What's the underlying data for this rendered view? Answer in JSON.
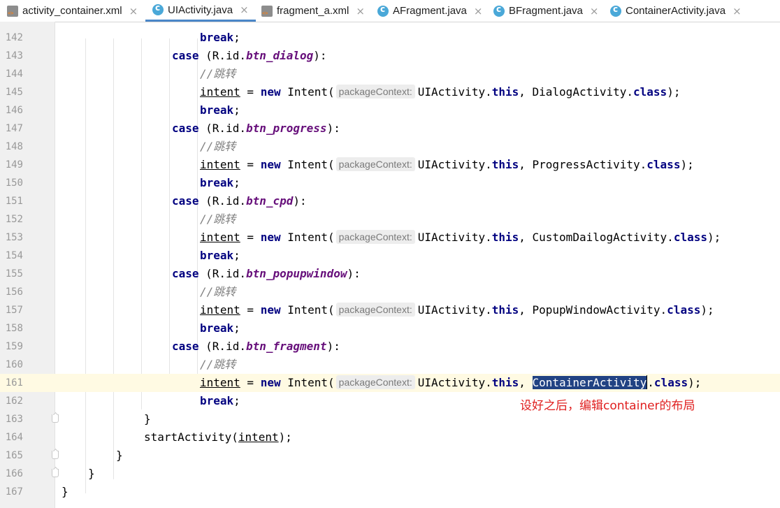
{
  "tabs": [
    {
      "name": "activity_container.xml",
      "type": "xml",
      "active": false
    },
    {
      "name": "UIActivity.java",
      "type": "java",
      "active": true
    },
    {
      "name": "fragment_a.xml",
      "type": "xml",
      "active": false
    },
    {
      "name": "AFragment.java",
      "type": "java",
      "active": false
    },
    {
      "name": "BFragment.java",
      "type": "java",
      "active": false
    },
    {
      "name": "ContainerActivity.java",
      "type": "java",
      "active": false
    }
  ],
  "close_glyph": "×",
  "editor": {
    "current_line": "161",
    "lines": [
      {
        "num": "142",
        "text": "break;"
      },
      {
        "num": "143",
        "text": "case (R.id.btn_dialog):"
      },
      {
        "num": "144",
        "text": "//跳转"
      },
      {
        "num": "145",
        "text": "intent = new Intent( packageContext: UIActivity.this, DialogActivity.class);"
      },
      {
        "num": "146",
        "text": "break;"
      },
      {
        "num": "147",
        "text": "case (R.id.btn_progress):"
      },
      {
        "num": "148",
        "text": "//跳转"
      },
      {
        "num": "149",
        "text": "intent = new Intent( packageContext: UIActivity.this, ProgressActivity.class);"
      },
      {
        "num": "150",
        "text": "break;"
      },
      {
        "num": "151",
        "text": "case (R.id.btn_cpd):"
      },
      {
        "num": "152",
        "text": "//跳转"
      },
      {
        "num": "153",
        "text": "intent = new Intent( packageContext: UIActivity.this, CustomDailogActivity.class);"
      },
      {
        "num": "154",
        "text": "break;"
      },
      {
        "num": "155",
        "text": "case (R.id.btn_popupwindow):"
      },
      {
        "num": "156",
        "text": "//跳转"
      },
      {
        "num": "157",
        "text": "intent = new Intent( packageContext: UIActivity.this, PopupWindowActivity.class);"
      },
      {
        "num": "158",
        "text": "break;"
      },
      {
        "num": "159",
        "text": "case (R.id.btn_fragment):"
      },
      {
        "num": "160",
        "text": "//跳转"
      },
      {
        "num": "161",
        "text": "intent = new Intent( packageContext: UIActivity.this, ContainerActivity.class);"
      },
      {
        "num": "162",
        "text": "break;"
      },
      {
        "num": "163",
        "text": "}"
      },
      {
        "num": "164",
        "text": "startActivity(intent);"
      },
      {
        "num": "165",
        "text": "}"
      },
      {
        "num": "166",
        "text": "}"
      },
      {
        "num": "167",
        "text": "}"
      }
    ],
    "selected_text": "ContainerActivity"
  },
  "annotation": "设好之后，编辑container的布局",
  "colors": {
    "keyword": "#000080",
    "field": "#660e7a",
    "comment": "#808080",
    "selection": "#214283",
    "annotation": "#e02020",
    "current_line": "#fffae3",
    "tab_underline": "#4a86c8"
  },
  "icons": {
    "java_file": "java-class-icon",
    "xml_file": "xml-layout-icon",
    "close": "close-icon",
    "fold": "fold-marker-icon"
  }
}
